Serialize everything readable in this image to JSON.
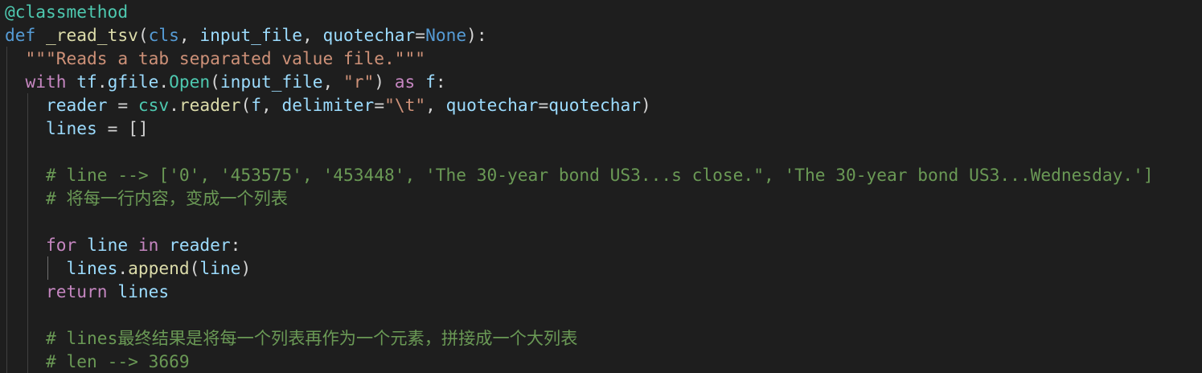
{
  "editor": {
    "language": "python",
    "colors": {
      "background": "#1e1e1e",
      "keyword": "#569cd6",
      "control": "#c586c0",
      "function": "#dcdcaa",
      "variable": "#9cdcfe",
      "string": "#ce9178",
      "class": "#4ec9b0",
      "comment": "#6a9955",
      "plain": "#d4d4d4"
    },
    "lines": [
      {
        "indent": 0,
        "tokens": [
          [
            "dec",
            "@classmethod"
          ]
        ]
      },
      {
        "indent": 0,
        "tokens": [
          [
            "kw",
            "def "
          ],
          [
            "fn",
            "_read_tsv"
          ],
          [
            "pl",
            "("
          ],
          [
            "kw",
            "cls"
          ],
          [
            "pl",
            ", "
          ],
          [
            "var",
            "input_file"
          ],
          [
            "pl",
            ", "
          ],
          [
            "var",
            "quotechar"
          ],
          [
            "pl",
            "="
          ],
          [
            "kw",
            "None"
          ],
          [
            "pl",
            "):"
          ]
        ]
      },
      {
        "indent": 1,
        "tokens": [
          [
            "str",
            "\"\"\"Reads a tab separated value file.\"\"\""
          ]
        ]
      },
      {
        "indent": 1,
        "tokens": [
          [
            "ctl",
            "with "
          ],
          [
            "var",
            "tf"
          ],
          [
            "pl",
            "."
          ],
          [
            "var",
            "gfile"
          ],
          [
            "pl",
            "."
          ],
          [
            "cls",
            "Open"
          ],
          [
            "pl",
            "("
          ],
          [
            "var",
            "input_file"
          ],
          [
            "pl",
            ", "
          ],
          [
            "str",
            "\"r\""
          ],
          [
            "pl",
            ") "
          ],
          [
            "ctl",
            "as "
          ],
          [
            "var",
            "f"
          ],
          [
            "pl",
            ":"
          ]
        ]
      },
      {
        "indent": 2,
        "tokens": [
          [
            "var",
            "reader"
          ],
          [
            "pl",
            " = "
          ],
          [
            "cls",
            "csv"
          ],
          [
            "pl",
            "."
          ],
          [
            "fn",
            "reader"
          ],
          [
            "pl",
            "("
          ],
          [
            "var",
            "f"
          ],
          [
            "pl",
            ", "
          ],
          [
            "var",
            "delimiter"
          ],
          [
            "pl",
            "="
          ],
          [
            "str",
            "\"\\t\""
          ],
          [
            "pl",
            ", "
          ],
          [
            "var",
            "quotechar"
          ],
          [
            "pl",
            "="
          ],
          [
            "var",
            "quotechar"
          ],
          [
            "pl",
            ")"
          ]
        ]
      },
      {
        "indent": 2,
        "tokens": [
          [
            "var",
            "lines"
          ],
          [
            "pl",
            " = []"
          ]
        ]
      },
      {
        "indent": 2,
        "tokens": []
      },
      {
        "indent": 2,
        "tokens": [
          [
            "cm",
            "# line --> ['0', '453575', '453448', 'The 30-year bond US3...s close.\", 'The 30-year bond US3...Wednesday.']"
          ]
        ]
      },
      {
        "indent": 2,
        "tokens": [
          [
            "cm",
            "# 将每一行内容，变成一个列表"
          ]
        ]
      },
      {
        "indent": 2,
        "tokens": []
      },
      {
        "indent": 2,
        "tokens": [
          [
            "ctl",
            "for "
          ],
          [
            "var",
            "line "
          ],
          [
            "ctl",
            "in "
          ],
          [
            "var",
            "reader"
          ],
          [
            "pl",
            ":"
          ]
        ]
      },
      {
        "indent": 3,
        "tokens": [
          [
            "var",
            "lines"
          ],
          [
            "pl",
            "."
          ],
          [
            "fn",
            "append"
          ],
          [
            "pl",
            "("
          ],
          [
            "var",
            "line"
          ],
          [
            "pl",
            ")"
          ]
        ]
      },
      {
        "indent": 2,
        "tokens": [
          [
            "ctl",
            "return "
          ],
          [
            "var",
            "lines"
          ]
        ]
      },
      {
        "indent": 2,
        "tokens": []
      },
      {
        "indent": 2,
        "tokens": [
          [
            "cm",
            "# lines最终结果是将每一个列表再作为一个元素，拼接成一个大列表"
          ]
        ]
      },
      {
        "indent": 2,
        "tokens": [
          [
            "cm",
            "# len --> 3669"
          ]
        ]
      }
    ]
  }
}
